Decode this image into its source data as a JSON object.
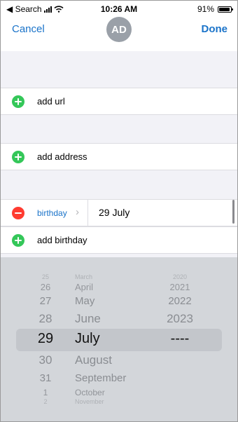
{
  "status_bar": {
    "back_label": "◀ Search",
    "time": "10:26 AM",
    "battery_percent": "91%",
    "battery_level": 0.91
  },
  "nav": {
    "cancel_label": "Cancel",
    "avatar_initials": "AD",
    "done_label": "Done"
  },
  "rows": {
    "add_url": "add url",
    "add_address": "add address",
    "birthday_label": "birthday",
    "birthday_chevron": "›",
    "birthday_value": "29 July",
    "add_birthday": "add birthday"
  },
  "picker": {
    "days": [
      "25",
      "26",
      "27",
      "28",
      "29",
      "30",
      "31",
      "1",
      "2"
    ],
    "months": [
      "March",
      "April",
      "May",
      "June",
      "July",
      "August",
      "September",
      "October",
      "November"
    ],
    "years": [
      "2020",
      "2021",
      "2022",
      "2023",
      "----"
    ],
    "selected_day": "29",
    "selected_month": "July",
    "selected_year": "----"
  },
  "colors": {
    "accent": "#1a73c9",
    "add": "#34c759",
    "remove": "#ff3b30"
  }
}
